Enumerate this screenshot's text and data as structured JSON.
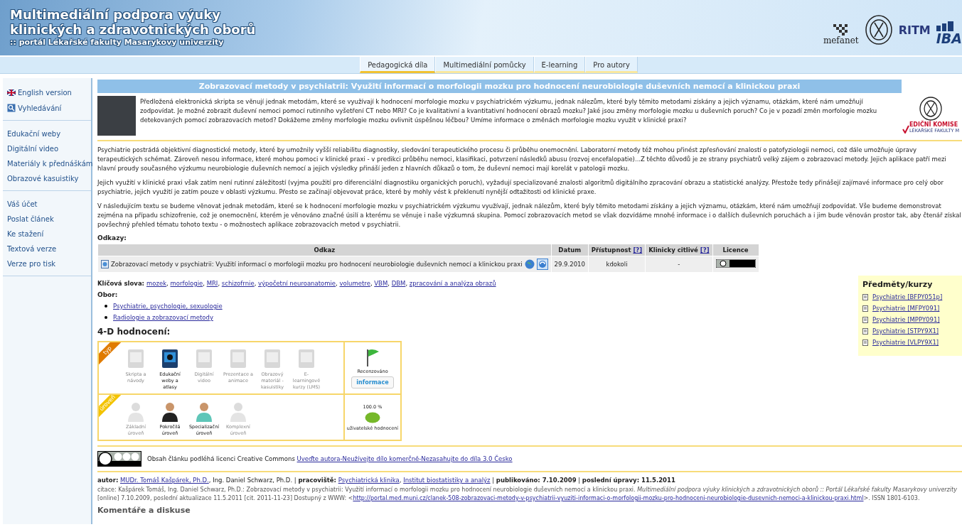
{
  "header": {
    "title_lines": [
      "Multimediální podpora výuky",
      "klinických a zdravotnických oborů"
    ],
    "subtitle": ":: portál Lékařské fakulty Masarykovy univerzity",
    "logos": [
      {
        "kind": "mefanet",
        "label": "mefanet"
      },
      {
        "kind": "seal"
      },
      {
        "kind": "ritm",
        "label": "RITM"
      },
      {
        "kind": "iba",
        "label": "IBA"
      }
    ]
  },
  "tabs": [
    {
      "label": "Pedagogická díla",
      "selected": true
    },
    {
      "label": "Multimediální pomůcky",
      "selected": false
    },
    {
      "label": "E-learning",
      "selected": false
    },
    {
      "label": "Pro autory",
      "selected": false
    }
  ],
  "sidebar": {
    "groups": [
      [
        {
          "label": "English version",
          "kind": "flag"
        },
        {
          "label": "Vyhledávání",
          "kind": "search"
        }
      ],
      [
        {
          "label": "Edukační weby",
          "kind": "plain"
        },
        {
          "label": "Digitální video",
          "kind": "plain"
        },
        {
          "label": "Materiály k přednáškám",
          "kind": "plain"
        },
        {
          "label": "Obrazové kasuistiky",
          "kind": "plain"
        }
      ],
      [
        {
          "label": "Váš účet",
          "kind": "plain"
        },
        {
          "label": "Poslat článek",
          "kind": "plain"
        },
        {
          "label": "Ke stažení",
          "kind": "plain"
        },
        {
          "label": "Textová verze",
          "kind": "plain"
        },
        {
          "label": "Verze pro tisk",
          "kind": "plain"
        }
      ]
    ]
  },
  "article": {
    "title": "Zobrazovací metody v psychiatrii: Využití informací o morfologii mozku pro hodnocení neurobiologie duševních nemocí a klinickou praxi",
    "badge_lines": [
      "EDIČNÍ KOMISE",
      "LÉKAŘSKÉ FAKULTY M"
    ],
    "intro": "Předložená elektronická skripta se věnují jednak metodám, které se využívají k hodnocení morfologie mozku v psychiatrickém výzkumu, jednak nálezům, které byly těmito metodami získány a jejich významu, otázkám, které nám umožňují zodpovídat. Je možné zobrazit duševní nemoci pomocí rutinního vyšetření CT nebo MRI? Co je kvalitativní a kvantitativní hodnocení obrazů mozku? Jaké jsou změny morfologie mozku u duševních poruch? Co je v pozadí změn morfologie mozku detekovaných pomocí zobrazovacích metod? Dokážeme změny morfologie mozku ovlivnit úspěšnou léčbou? Umíme informace o změnách morfologie mozku využít v klinické praxi?",
    "paragraphs": [
      "Psychiatrie postrádá objektivní diagnostické metody, které by umožnily vyšší reliabilitu diagnostiky, sledování terapeutického procesu či průběhu onemocnění. Laboratorní metody též mohou přinést zpřesňování znalostí o patofyziologii nemoci, což dále umožňuje úpravy terapeutických schémat. Zároveň nesou informace, které mohou pomoci v klinické praxi - v predikci průběhu nemoci, klasifikaci, potvrzení následků abusu (rozvoj encefalopatie)...Z těchto důvodů je ze strany psychiatrů velký zájem o zobrazovací metody. Jejich aplikace patří mezi hlavní proudy současného výzkumu neurobiologie duševních nemocí a jejich výsledky přináší jeden z hlavních důkazů o tom, že duševní nemoci mají korelát v patologii mozku.",
      "Jejich využití v klinické praxi však zatím není rutinní záležitostí (vyjma použití pro diferenciální diagnostiku organických poruch), vyžadují specializované znalosti algoritmů digitálního zpracování obrazu a statistické analýzy. Přestože tedy přinášejí zajímavé informace pro celý obor psychiatrie, jejich využití je zatím pouze v oblasti výzkumu. Přesto se začínají objevovat práce, které by mohly vést k překlenutí nynější odtažitosti od klinické praxe.",
      "V následujícím textu se budeme věnovat jednak metodám, které se k hodnocení morfologie mozku v psychiatrickém výzkumu využívají, jednak nálezům, které byly těmito metodami získány a jejich významu, otázkám, které nám umožňují zodpovídat. Vše budeme demonstrovat zejména na případu schizofrenie, což je onemocnění, kterém je věnováno značné úsilí a kterému se věnuje i naše výzkumná skupina. Pomocí zobrazovacích metod se však dozvídáme mnohé informace i o dalších duševních poruchách a i jim bude věnován prostor tak, aby čtenář získal povšechný přehled tématu tohoto textu - o možnostech aplikace zobrazovacích metod v psychiatrii."
    ]
  },
  "links": {
    "heading": "Odkazy:",
    "columns": [
      {
        "label": "Odkaz"
      },
      {
        "label": "Datum"
      },
      {
        "label": "Přístupnost",
        "help": "[?]"
      },
      {
        "label": "Klinicky citlivé",
        "help": "[?]"
      },
      {
        "label": "Licence"
      }
    ],
    "rows": [
      {
        "title": "Zobrazovací metody v psychiatrii: Využití informací o morfologii mozku pro hodnocení neurobiologie duševních nemocí a klinickou praxi",
        "date": "29.9.2010",
        "access": "kdokoli",
        "sensitive": "-"
      }
    ]
  },
  "keywords": {
    "label": "Klíčová slova:",
    "separator": ",",
    "items": [
      "mozek",
      "morfologie",
      "MRI",
      "schizofrnie",
      "výpočetní neuroanatomie",
      "volumetre",
      "VBM",
      "DBM",
      "zpracování a analýza obrazů"
    ]
  },
  "field": {
    "label": "Obor:",
    "items": [
      "Psychiatrie, psychologie, sexuologie",
      "Radiologie a zobrazovací metody"
    ]
  },
  "courses": {
    "title": "Předměty/kurzy",
    "items": [
      "Psychiatrie [BFPY051p]",
      "Psychiatrie [MFPY091]",
      "Psychiatrie [MPPY091]",
      "Psychiatrie [STPY9X1]",
      "Psychiatrie [VLPY9X1]"
    ]
  },
  "rating": {
    "title": "4-D hodnocení:",
    "rows": [
      {
        "ribbon": "typ",
        "kind": "type",
        "items": [
          {
            "label": "Skripta a návody",
            "selected": false
          },
          {
            "label": "Edukační weby a atlasy",
            "selected": true
          },
          {
            "label": "Digitální video",
            "selected": false
          },
          {
            "label": "Prezentace a animace",
            "selected": false
          },
          {
            "label": "Obrazový materiál - kasuistiky",
            "selected": false
          },
          {
            "label": "E-learningové kurzy (LMS)",
            "selected": false
          }
        ],
        "side": {
          "kind": "review",
          "label": "Recenzováno",
          "button": "informace"
        }
      },
      {
        "ribbon": "úroveň",
        "kind": "level",
        "items": [
          {
            "label": "Základní úroveň",
            "selected": false
          },
          {
            "label": "Pokročilá úroveň",
            "selected": true
          },
          {
            "label": "Specializační úroveň",
            "selected": true
          },
          {
            "label": "Komplexní úroveň",
            "selected": false
          }
        ],
        "side": {
          "kind": "score",
          "value": "100.0 %",
          "label": "uživatelské hodnocení"
        }
      }
    ]
  },
  "license": {
    "text": "Obsah článku podléhá licenci Creative Commons ",
    "link": "Uveďte autora-Neužívejte dílo komerčně-Nezasahujte do díla 3.0 Česko"
  },
  "author_line": [
    {
      "kind": "text",
      "text": "**autor:** "
    },
    {
      "kind": "link",
      "text": "MUDr. Tomáš Kašpárek, Ph.D."
    },
    {
      "kind": "text",
      "text": ", Ing. Daniel Schwarz, Ph.D. | **pracoviště:** "
    },
    {
      "kind": "link",
      "text": "Psychiatrická klinika"
    },
    {
      "kind": "text",
      "text": ", "
    },
    {
      "kind": "link",
      "text": "Institut biostatistiky a analýz"
    },
    {
      "kind": "text",
      "text": " | **publikováno: 7.10.2009** | **poslední úpravy: 11.5.2011**"
    }
  ],
  "citation": [
    {
      "kind": "text",
      "text": "citace: Kašpárek Tomáš, Ing. Daniel Schwarz, Ph.D.: Zobrazovací metody v psychiatrii: Využití informací o morfologii mozku pro hodnocení neurobiologie duševních nemocí a klinickou praxi. *Multimediální podpora výuky klinických a zdravotnických oborů :: Portál Lékařské fakulty Masarykovy univerzity* [online] 7.10.2009, poslední aktualizace 11.5.2011 [cit. 2011-11-23] Dostupný z WWW: <"
    },
    {
      "kind": "link",
      "text": "http://portal.med.muni.cz/clanek-508-zobrazovaci-metody-v-psychiatrii-vyuziti-informaci-o-morfologii-mozku-pro-hodnoceni-neurobiologie-dusevnich-nemoci-a-klinickou-praxi.html"
    },
    {
      "kind": "text",
      "text": ">. ISSN 1801-6103."
    }
  ],
  "comments_heading": "Komentáře a diskuse"
}
